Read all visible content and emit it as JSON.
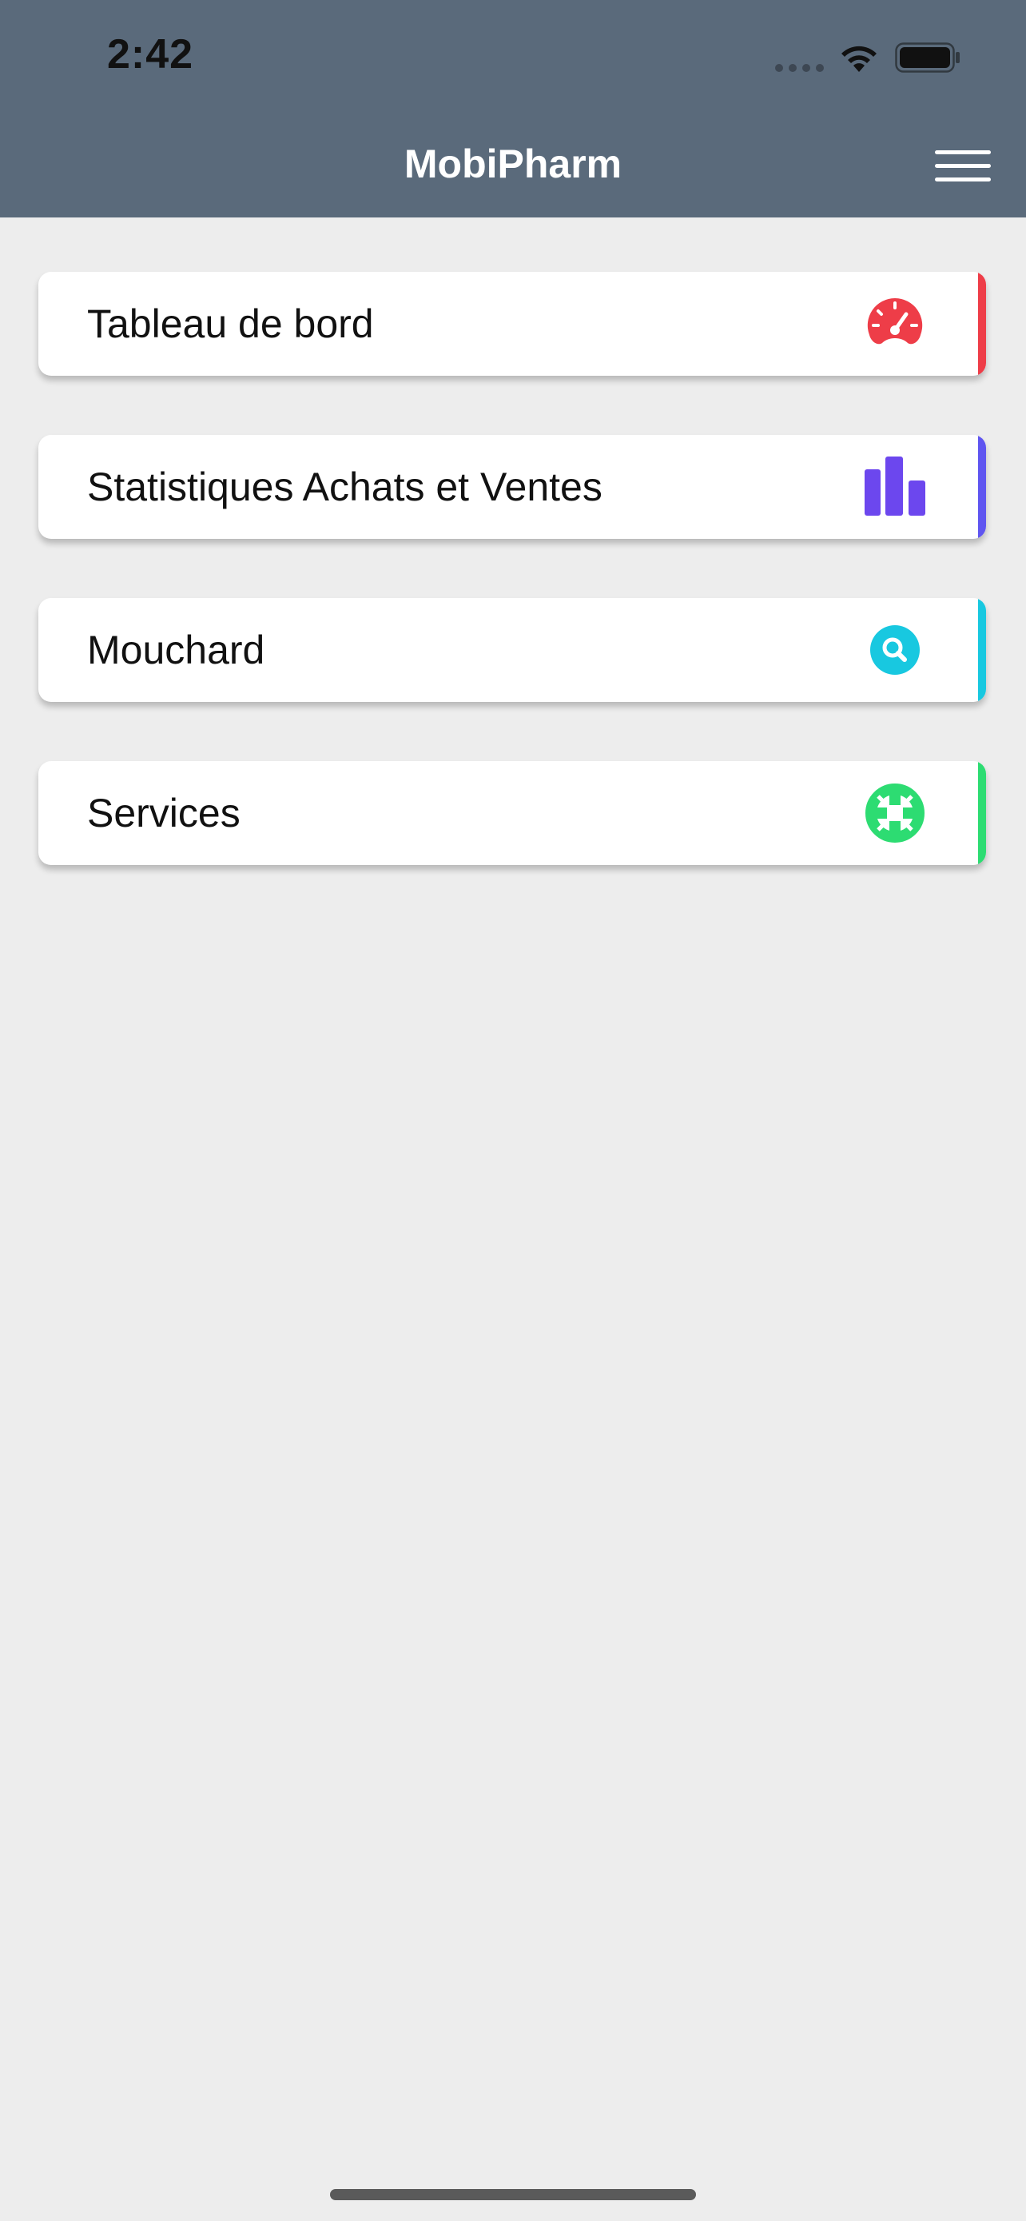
{
  "status_bar": {
    "time": "2:42"
  },
  "header": {
    "title": "MobiPharm",
    "menu_icon": "hamburger-menu-icon"
  },
  "menu_items": [
    {
      "label": "Tableau de bord",
      "icon": "speedometer-icon",
      "color": "#ee3d48"
    },
    {
      "label": "Statistiques Achats et Ventes",
      "icon": "bar-chart-icon",
      "color": "#5f55f0"
    },
    {
      "label": "Mouchard",
      "icon": "search-icon",
      "color": "#18c8e0"
    },
    {
      "label": "Services",
      "icon": "lifebuoy-icon",
      "color": "#2ddc72"
    }
  ],
  "colors": {
    "header_bg": "#5a6a7b",
    "page_bg": "#ededed",
    "bar_chart_fill": "#6c47ee"
  }
}
